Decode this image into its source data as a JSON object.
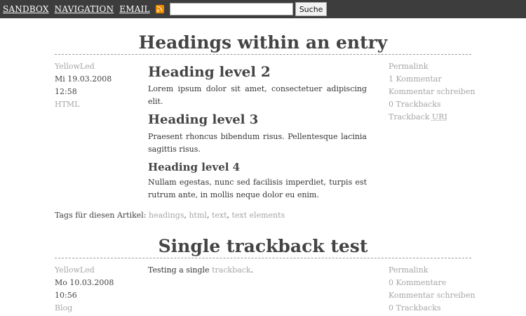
{
  "topbar": {
    "nav": [
      "Sandbox",
      "Navigation",
      "Email"
    ],
    "search_placeholder": "",
    "search_button": "Suche",
    "rss_icon": "rss-icon"
  },
  "articles": [
    {
      "title": "Headings within an entry",
      "meta_left": [
        "YellowLed",
        "Mi 19.03.2008",
        "12:58",
        "HTML"
      ],
      "meta_right": [
        "Permalink",
        "1 Kommentar",
        "Kommentar schreiben",
        "0 Trackbacks",
        "Trackback",
        "URI"
      ],
      "content": {
        "h2": "Heading level 2",
        "p1": "Lorem ipsum dolor sit amet, consectetuer adipiscing elit.",
        "h3": "Heading level 3",
        "p2": "Praesent rhoncus bibendum risus. Pellentesque lacinia sagittis risus.",
        "h4": "Heading level 4",
        "p3": "Nullam egestas, nunc sed facilisis imperdiet, turpis est rutrum ante, in mollis neque dolor eu enim."
      },
      "tags_label": "Tags für diesen Artikel:",
      "tags": [
        "headings",
        "html",
        "text",
        "text elements"
      ]
    },
    {
      "title": "Single trackback test",
      "meta_left": [
        "YellowLed",
        "Mo 10.03.2008",
        "10:56",
        "Blog"
      ],
      "meta_right": [
        "Permalink",
        "0 Kommentare",
        "Kommentar schreiben",
        "0 Trackbacks"
      ],
      "content": {
        "text_prefix": "Testing a single ",
        "link": "trackback",
        "text_suffix": "."
      }
    }
  ]
}
